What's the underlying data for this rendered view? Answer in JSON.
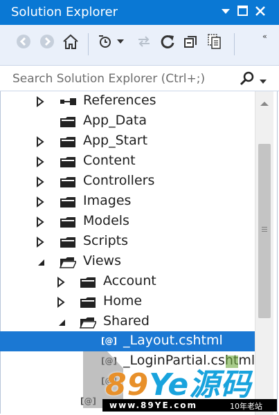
{
  "window": {
    "title": "Solution Explorer",
    "buttons": {
      "dropdown": "▾",
      "maximize": "□",
      "close": "✕"
    }
  },
  "toolbar": {
    "icons": [
      "back-icon",
      "forward-icon",
      "home-icon",
      "pending-changes-filter-icon",
      "sync-with-active-document-icon",
      "refresh-icon",
      "collapse-all-icon",
      "show-all-files-icon"
    ],
    "overflow": "‹‹"
  },
  "search": {
    "placeholder": "Search Solution Explorer (Ctrl+;)"
  },
  "tree": {
    "items": [
      {
        "label": "References",
        "type": "references",
        "expanded": false,
        "has_children": true
      },
      {
        "label": "App_Data",
        "type": "folder",
        "has_children": false
      },
      {
        "label": "App_Start",
        "type": "folder",
        "expanded": false,
        "has_children": true
      },
      {
        "label": "Content",
        "type": "folder",
        "expanded": false,
        "has_children": true
      },
      {
        "label": "Controllers",
        "type": "folder",
        "expanded": false,
        "has_children": true
      },
      {
        "label": "Images",
        "type": "folder",
        "expanded": false,
        "has_children": true
      },
      {
        "label": "Models",
        "type": "folder",
        "expanded": false,
        "has_children": true
      },
      {
        "label": "Scripts",
        "type": "folder",
        "expanded": false,
        "has_children": true
      },
      {
        "label": "Views",
        "type": "folder",
        "expanded": true,
        "has_children": true
      },
      {
        "label": "Account",
        "type": "folder",
        "expanded": false,
        "has_children": true
      },
      {
        "label": "Home",
        "type": "folder",
        "expanded": false,
        "has_children": true
      },
      {
        "label": "Shared",
        "type": "folder",
        "expanded": true,
        "has_children": true
      },
      {
        "label": "_Layout.cshtml",
        "type": "file",
        "selected": true
      },
      {
        "label": "_LoginPartial.cshtml",
        "type": "file"
      }
    ],
    "file_icon_text": "[@]"
  },
  "watermark": {
    "brand_number": "89",
    "brand_text": "Ye源码",
    "url": "www.89YE.com",
    "tag": "10年老站"
  },
  "colors": {
    "titlebar": "#0a78d4",
    "toolbar": "#eaf0fa",
    "selection": "#1b78d3"
  }
}
